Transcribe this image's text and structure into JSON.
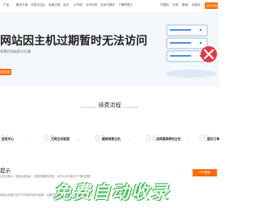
{
  "nav": {
    "items": [
      "产品",
      "解决方案",
      "文档与社区",
      "免费试用",
      "定价",
      "云市场",
      "合作伙伴",
      "支持与服务",
      "了解阿里云"
    ],
    "right_links": [
      "中国站",
      "文档",
      "备案",
      "控制台"
    ],
    "register_label": "立即注册"
  },
  "hero": {
    "title": "网站因主机过期暂时无法访问",
    "subtitle": "续费后网站即可开通",
    "button_label": "立即续费"
  },
  "renew_flow": {
    "title": "续费流程",
    "steps": [
      {
        "num": "01",
        "label": "会员中心"
      },
      {
        "num": "02",
        "label": "万网主机管理"
      },
      {
        "num": "03",
        "label": "继续续费主机"
      },
      {
        "num": "04",
        "label": "选择要续费的主机"
      },
      {
        "num": "05",
        "label": "提交订单"
      }
    ]
  },
  "tips": {
    "title": "提示",
    "line1": "主机到期后，数据会被保留，如果需要备份数据，请在30天内通过FTP备份数据",
    "line2": "续费后如果仍然打不开网站请联系客服，如果您是网站访问者，请联系网站管理员",
    "contact_label": "ICP备案"
  },
  "watermark": "免费自动收录",
  "colors": {
    "accent": "#ff6a00",
    "hero_bg": "#f4f8fc",
    "server_blue": "#4a90e2",
    "alert_red": "#e5393d"
  }
}
